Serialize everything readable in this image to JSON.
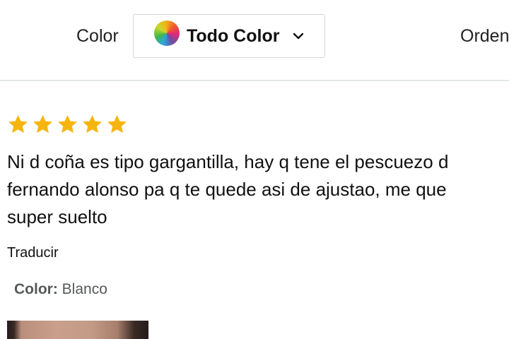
{
  "filters": {
    "color_label": "Color",
    "color_value": "Todo Color",
    "color_swatch_icon": "rainbow-swatch",
    "sort_label": "Orden"
  },
  "review": {
    "rating": 5,
    "rating_max": 5,
    "star_color": "#f6b50e",
    "text_lines": [
      "Ni d coña es tipo gargantilla, hay q tene el pescuezo d",
      "fernando alonso pa q te quede asi de ajustao, me que",
      "super suelto"
    ],
    "translate_label": "Traducir",
    "variant": {
      "key": "Color:",
      "value": " Blanco"
    }
  }
}
